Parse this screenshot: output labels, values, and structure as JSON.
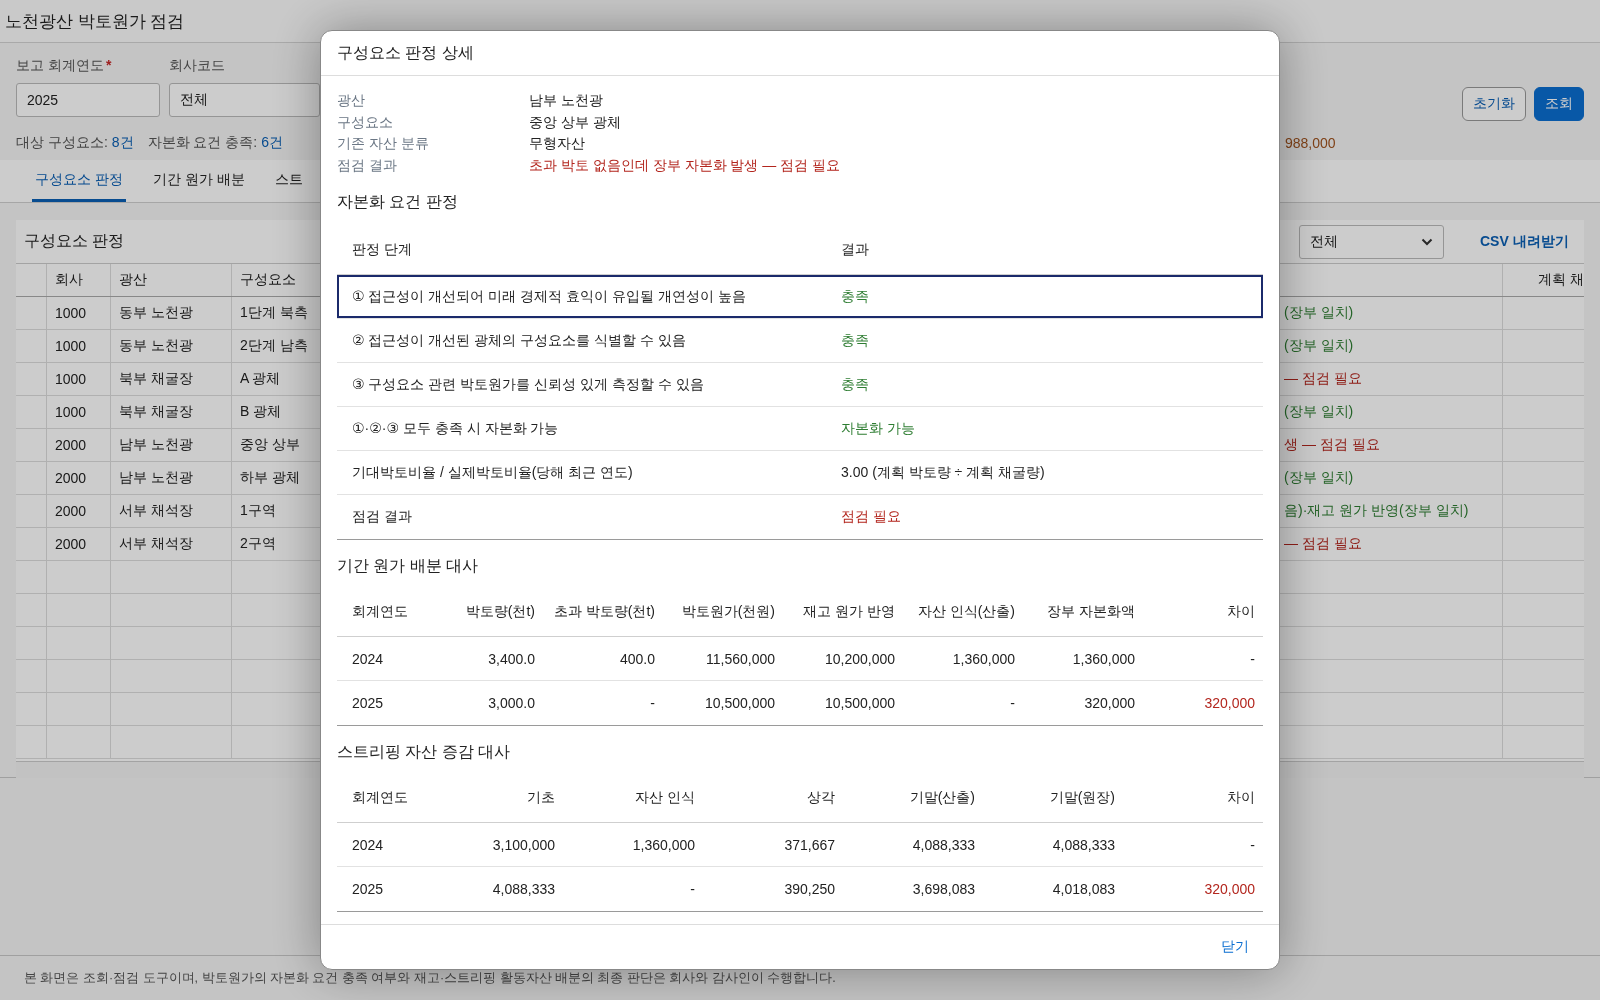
{
  "page": {
    "title": "노천광산 박토원가 점검",
    "filters": [
      {
        "kind": "input",
        "label": "보고 회계연도",
        "required_mark": "*",
        "value": "2025"
      },
      {
        "kind": "select",
        "label": "회사코드",
        "value": "전체"
      }
    ],
    "buttons": [
      {
        "label": "초기화",
        "primary": false
      },
      {
        "label": "조회",
        "primary": true
      }
    ],
    "summary": [
      {
        "label": "대상 구성요소:",
        "value": "8건"
      },
      {
        "label": "자본화 요건 충족:",
        "value": "6건"
      }
    ],
    "summary_tail": "988,000",
    "tabs": [
      {
        "label": "구성요소 판정",
        "selected": true
      },
      {
        "label": "기간 원가 배분",
        "selected": false
      },
      {
        "label": "스트",
        "selected": false
      }
    ],
    "card": {
      "title": "구성요소 판정",
      "filter_value": "전체",
      "csv_link": "CSV 내려받기",
      "columns": [
        "회사",
        "광산",
        "구성요소"
      ],
      "last_column": "계획 채",
      "rows": [
        {
          "company": "1000",
          "mine": "동부 노천광",
          "component": "1단계 북측",
          "result": "(장부 일치)",
          "needs_review": false
        },
        {
          "company": "1000",
          "mine": "동부 노천광",
          "component": "2단계 남측",
          "result": "(장부 일치)",
          "needs_review": false
        },
        {
          "company": "1000",
          "mine": "북부 채굴장",
          "component": "A 광체",
          "result": "— 점검 필요",
          "needs_review": true
        },
        {
          "company": "1000",
          "mine": "북부 채굴장",
          "component": "B 광체",
          "result": "(장부 일치)",
          "needs_review": false
        },
        {
          "company": "2000",
          "mine": "남부 노천광",
          "component": "중앙 상부",
          "result": "생 — 점검 필요",
          "needs_review": true
        },
        {
          "company": "2000",
          "mine": "남부 노천광",
          "component": "하부 광체",
          "result": "(장부 일치)",
          "needs_review": false
        },
        {
          "company": "2000",
          "mine": "서부 채석장",
          "component": "1구역",
          "result": "음)·재고 원가 반영(장부 일치)",
          "needs_review": false
        },
        {
          "company": "2000",
          "mine": "서부 채석장",
          "component": "2구역",
          "result": "— 점검 필요",
          "needs_review": true
        }
      ]
    },
    "footer": "본 화면은 조회·점검 도구이며, 박토원가의 자본화 요건 충족 여부와 재고·스트리핑 활동자산 배분의 최종 판단은 회사와 감사인이 수행합니다."
  },
  "dialog": {
    "title": "구성요소 판정 상세",
    "info": [
      {
        "label": "광산",
        "value": "남부 노천광",
        "color": "#222222"
      },
      {
        "label": "구성요소",
        "value": "중앙 상부 광체",
        "color": "#222222"
      },
      {
        "label": "기존 자산 분류",
        "value": "무형자산",
        "color": "#222222"
      },
      {
        "label": "점검 결과",
        "value": "초과 박토 없음인데 장부 자본화 발생 — 점검 필요",
        "color": "#b3261e"
      }
    ],
    "criteria": {
      "title": "자본화 요건 판정",
      "columns": [
        "판정 단계",
        "결과"
      ],
      "rows": [
        {
          "step": "① 접근성이 개선되어 미래 경제적 효익이 유입될 개연성이 높음",
          "result": "충족",
          "color": "#2e7d32",
          "selected": true
        },
        {
          "step": "② 접근성이 개선된 광체의 구성요소를 식별할 수 있음",
          "result": "충족",
          "color": "#2e7d32",
          "selected": false
        },
        {
          "step": "③ 구성요소 관련 박토원가를 신뢰성 있게 측정할 수 있음",
          "result": "충족",
          "color": "#2e7d32",
          "selected": false
        },
        {
          "step": "①·②·③ 모두 충족 시 자본화 가능",
          "result": "자본화 가능",
          "color": "#2e7d32",
          "selected": false
        },
        {
          "step": "기대박토비율 / 실제박토비율(당해 최근 연도)",
          "result": "3.00 (계획 박토량 ÷ 계획 채굴량)",
          "color": "#222222",
          "selected": false
        },
        {
          "step": "점검 결과",
          "result": "점검 필요",
          "color": "#b3261e",
          "selected": false
        }
      ]
    },
    "allocation": {
      "title": "기간 원가 배분 대사",
      "columns": [
        "회계연도",
        "박토량(천t)",
        "초과 박토량(천t)",
        "박토원가(천원)",
        "재고 원가 반영",
        "자산 인식(산출)",
        "장부 자본화액",
        "차이"
      ],
      "rows": [
        {
          "cells": [
            "2024",
            "3,400.0",
            "400.0",
            "11,560,000",
            "10,200,000",
            "1,360,000",
            "1,360,000",
            "-"
          ],
          "mismatch": false
        },
        {
          "cells": [
            "2025",
            "3,000.0",
            "-",
            "10,500,000",
            "10,500,000",
            "-",
            "320,000",
            "320,000"
          ],
          "mismatch": true
        }
      ]
    },
    "stripping": {
      "title": "스트리핑 자산 증감 대사",
      "columns": [
        "회계연도",
        "기초",
        "자산 인식",
        "상각",
        "기말(산출)",
        "기말(원장)",
        "차이"
      ],
      "rows": [
        {
          "cells": [
            "2024",
            "3,100,000",
            "1,360,000",
            "371,667",
            "4,088,333",
            "4,088,333",
            "-"
          ],
          "mismatch": false
        },
        {
          "cells": [
            "2025",
            "4,088,333",
            "-",
            "390,250",
            "3,698,083",
            "4,018,083",
            "320,000"
          ],
          "mismatch": true
        }
      ]
    },
    "close": "닫기"
  }
}
